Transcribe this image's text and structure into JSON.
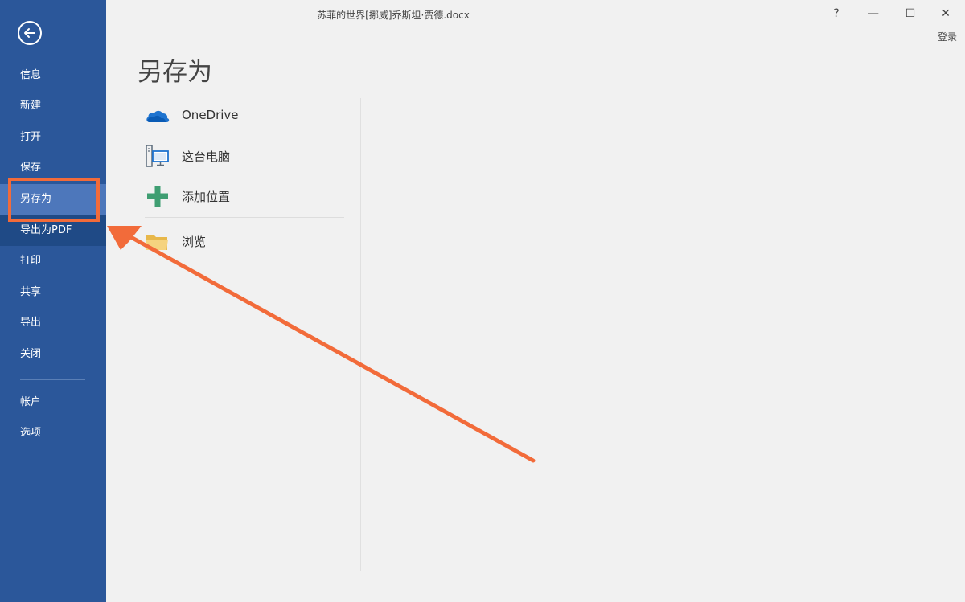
{
  "window": {
    "doc_title": "苏菲的世界[挪威]乔斯坦·贾德.docx",
    "help_label": "?",
    "minimize_label": "—",
    "maximize_label": "☐",
    "close_label": "✕",
    "login_label": "登录"
  },
  "sidebar": {
    "back_icon": "back-arrow-icon",
    "items": [
      {
        "label": "信息"
      },
      {
        "label": "新建"
      },
      {
        "label": "打开"
      },
      {
        "label": "保存"
      },
      {
        "label": "另存为",
        "selected": true
      },
      {
        "label": "导出为PDF"
      },
      {
        "label": "打印"
      },
      {
        "label": "共享"
      },
      {
        "label": "导出"
      },
      {
        "label": "关闭"
      },
      {
        "label": "帐户"
      },
      {
        "label": "选项"
      }
    ]
  },
  "main": {
    "title": "另存为",
    "locations": [
      {
        "label": "OneDrive",
        "icon": "onedrive-cloud-icon"
      },
      {
        "label": "这台电脑",
        "icon": "this-pc-icon"
      },
      {
        "label": "添加位置",
        "icon": "add-place-icon"
      },
      {
        "label": "浏览",
        "icon": "folder-icon"
      }
    ]
  },
  "colors": {
    "sidebar": "#2b579a",
    "sidebar_selected": "#4d77bb",
    "annotation": "#f26b3a",
    "background": "#f1f1f1"
  }
}
